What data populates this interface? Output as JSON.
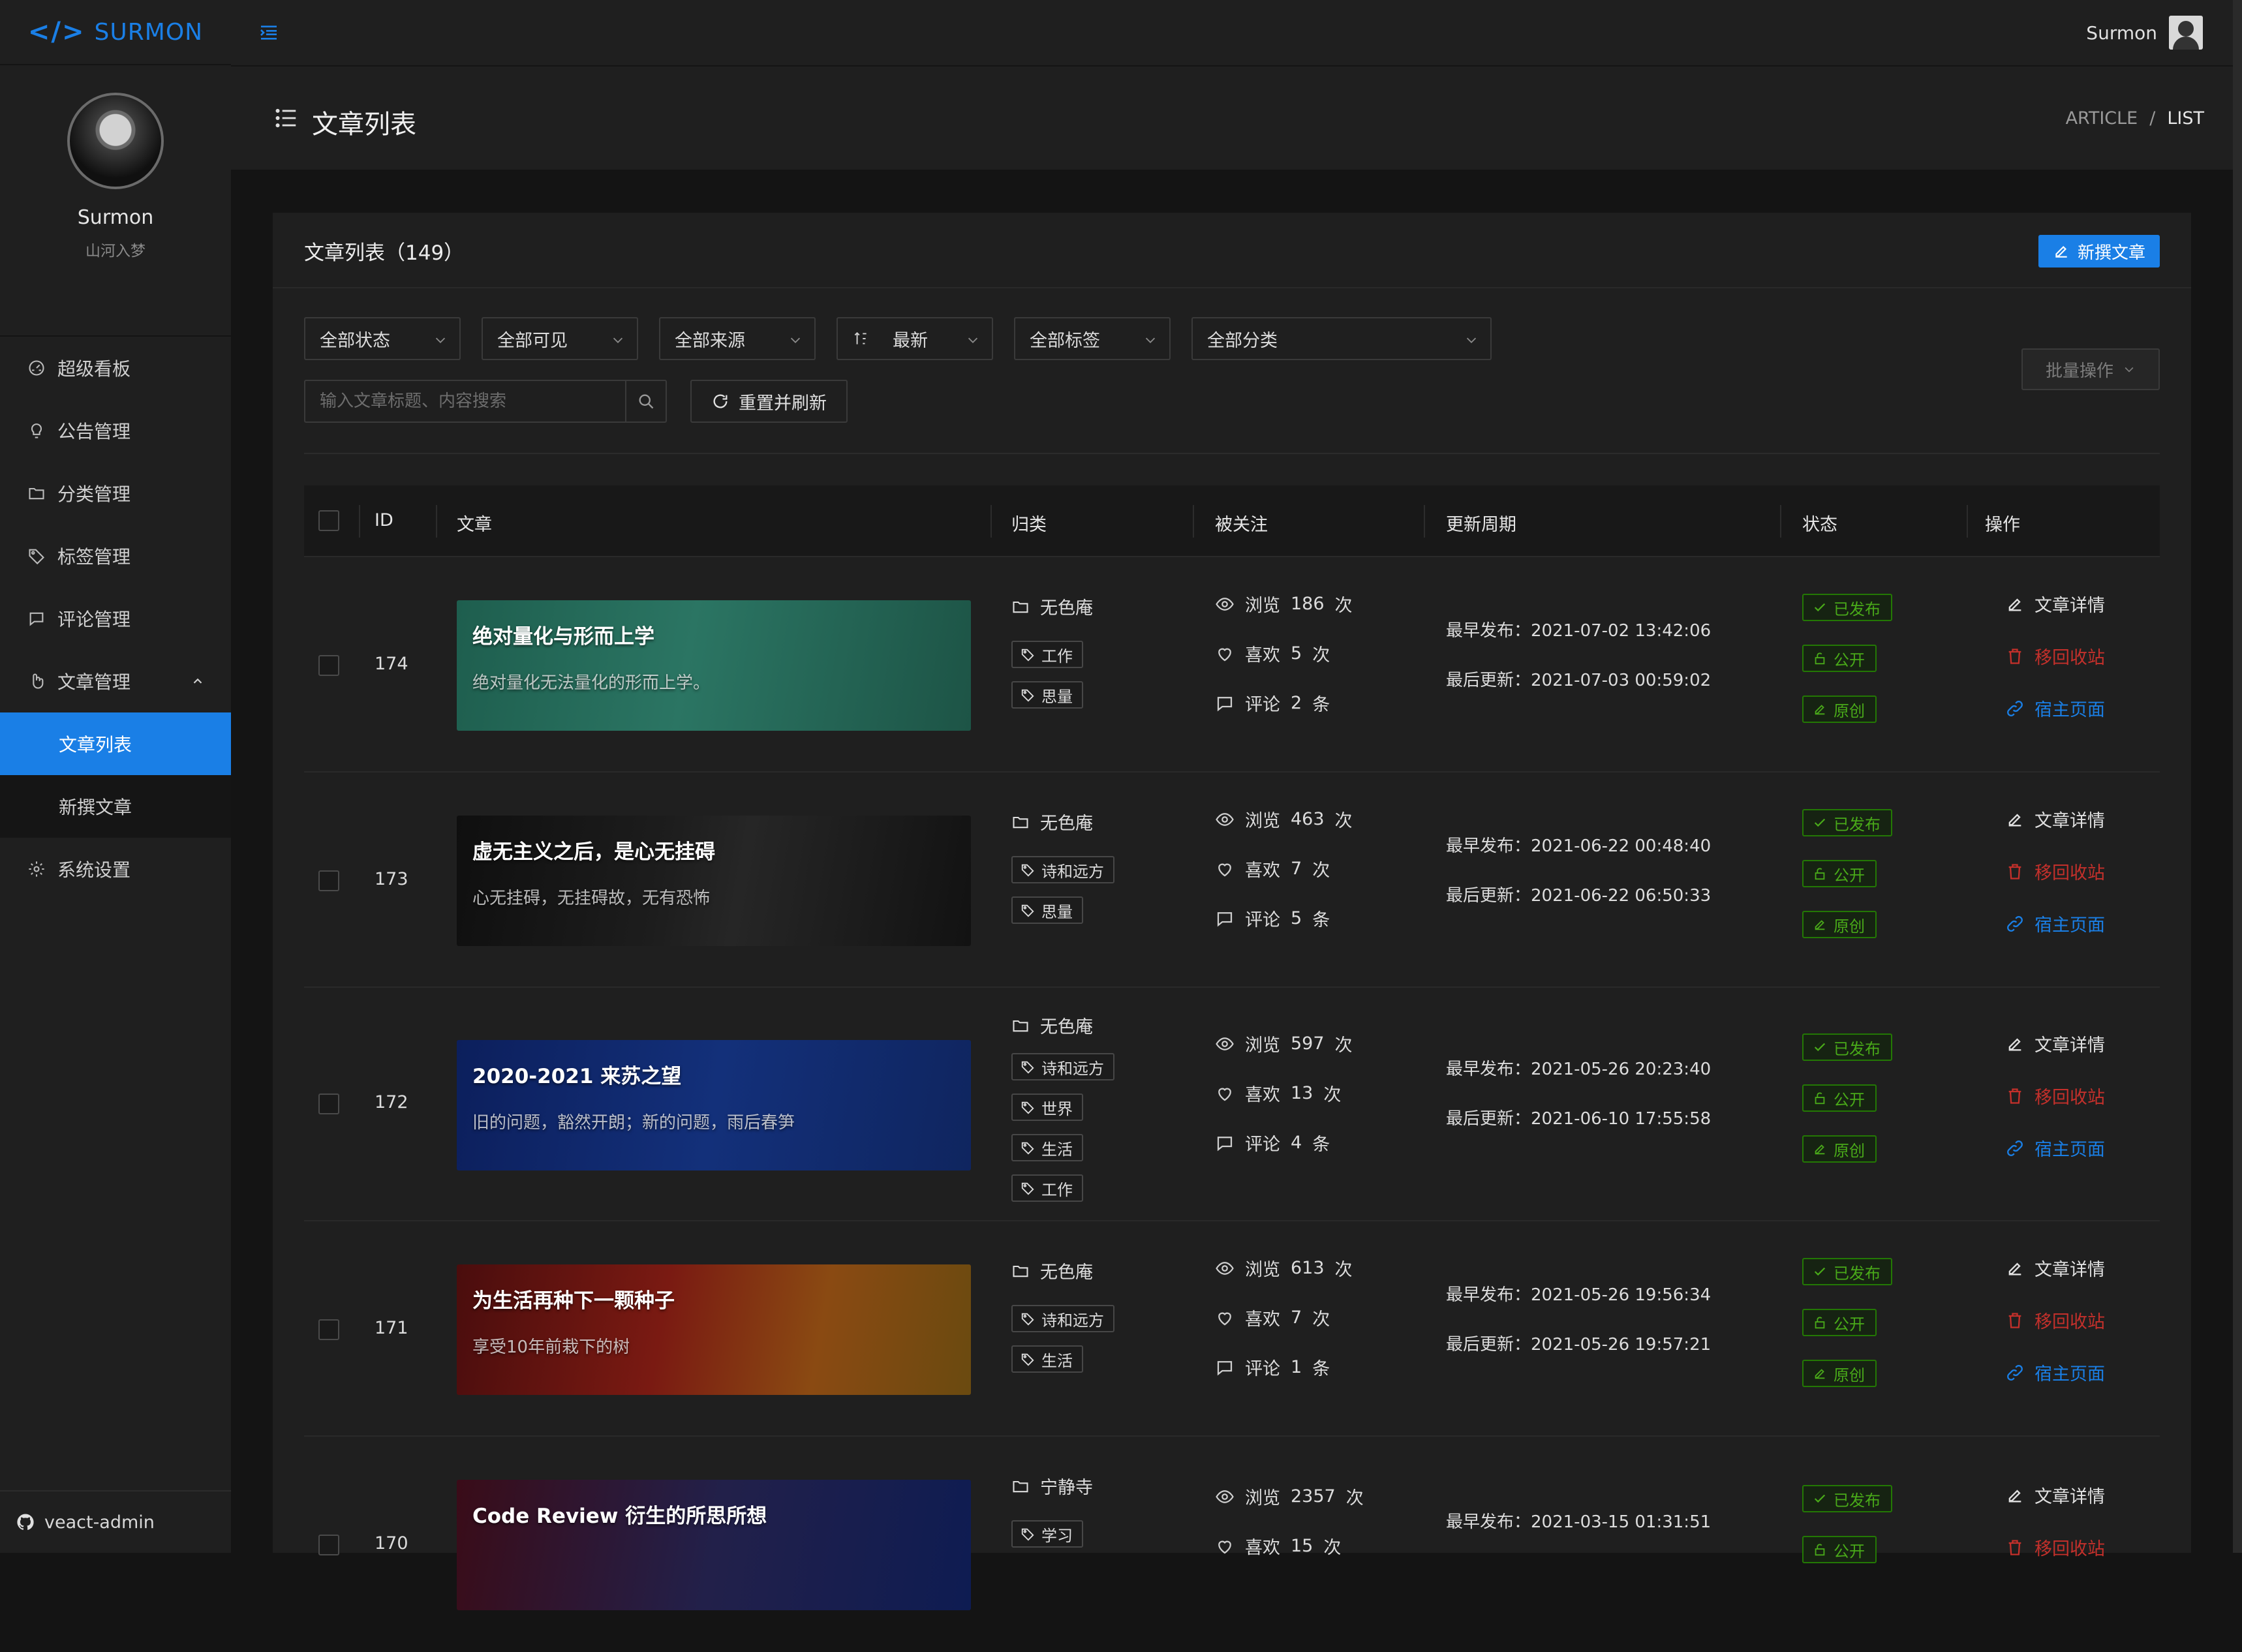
{
  "brand": {
    "code_symbol": "</>",
    "name": "SURMON"
  },
  "profile": {
    "name": "Surmon",
    "slogan": "山河入梦"
  },
  "nav": {
    "items": [
      {
        "label": "超级看板",
        "icon": "dashboard-icon"
      },
      {
        "label": "公告管理",
        "icon": "bulb-icon"
      },
      {
        "label": "分类管理",
        "icon": "folder-icon"
      },
      {
        "label": "标签管理",
        "icon": "tag-icon"
      },
      {
        "label": "评论管理",
        "icon": "comment-icon"
      },
      {
        "label": "文章管理",
        "icon": "article-icon"
      }
    ],
    "sub_items": [
      {
        "label": "文章列表",
        "active": true
      },
      {
        "label": "新撰文章",
        "active": false
      }
    ],
    "settings": {
      "label": "系统设置",
      "icon": "gear-icon"
    }
  },
  "footer": {
    "label": "veact-admin",
    "icon": "github-icon"
  },
  "header": {
    "user_name": "Surmon"
  },
  "page": {
    "title": "文章列表",
    "breadcrumb": [
      "ARTICLE",
      "/",
      "LIST"
    ]
  },
  "card": {
    "title": "文章列表（149）",
    "new_button": "新撰文章"
  },
  "filters": {
    "status": "全部状态",
    "visibility": "全部可见",
    "origin": "全部来源",
    "sort": "最新",
    "tags": "全部标签",
    "category": "全部分类",
    "search_placeholder": "输入文章标题、内容搜索",
    "reset_button": "重置并刷新",
    "batch_button": "批量操作"
  },
  "table": {
    "headers": {
      "id": "ID",
      "article": "文章",
      "category": "归类",
      "stats": "被关注",
      "period": "更新周期",
      "state": "状态",
      "ops": "操作"
    },
    "stat_labels": {
      "views": "浏览",
      "likes": "喜欢",
      "comments": "评论",
      "times": "次",
      "items": "条"
    },
    "date_labels": {
      "first": "最早发布：",
      "last": "最后更新："
    },
    "badges": {
      "published": "已发布",
      "public": "公开",
      "original": "原创"
    },
    "actions": {
      "detail": "文章详情",
      "trash": "移回收站",
      "link": "宿主页面"
    },
    "rows": [
      {
        "id": "174",
        "title": "绝对量化与形而上学",
        "desc": "绝对量化无法量化的形而上学。",
        "category": "无色庵",
        "tags": [
          "工作",
          "思量"
        ],
        "views": "186",
        "likes": "5",
        "comments": "2",
        "first": "2021-07-02 13:42:06",
        "last": "2021-07-03 00:59:02"
      },
      {
        "id": "173",
        "title": "虚无主义之后，是心无挂碍",
        "desc": "心无挂碍，无挂碍故，无有恐怖",
        "category": "无色庵",
        "tags": [
          "诗和远方",
          "思量"
        ],
        "views": "463",
        "likes": "7",
        "comments": "5",
        "first": "2021-06-22 00:48:40",
        "last": "2021-06-22 06:50:33"
      },
      {
        "id": "172",
        "title": "2020-2021 来苏之望",
        "desc": "旧的问题，豁然开朗；新的问题，雨后春笋",
        "category": "无色庵",
        "tags": [
          "诗和远方",
          "世界",
          "生活",
          "工作"
        ],
        "views": "597",
        "likes": "13",
        "comments": "4",
        "first": "2021-05-26 20:23:40",
        "last": "2021-06-10 17:55:58"
      },
      {
        "id": "171",
        "title": "为生活再种下一颗种子",
        "desc": "享受10年前栽下的树",
        "category": "无色庵",
        "tags": [
          "诗和远方",
          "生活"
        ],
        "views": "613",
        "likes": "7",
        "comments": "1",
        "first": "2021-05-26 19:56:34",
        "last": "2021-05-26 19:57:21"
      },
      {
        "id": "170",
        "title": "Code Review 衍生的所思所想",
        "desc": "",
        "category": "宁静寺",
        "tags": [
          "学习"
        ],
        "views": "2357",
        "likes": "15",
        "comments": "",
        "first": "2021-03-15 01:31:51",
        "last": ""
      }
    ]
  },
  "colors": {
    "primary": "#1a7fe6",
    "success": "#49aa19",
    "danger": "#c4302b",
    "bg": "#141414",
    "panel": "#1f1f1f"
  }
}
